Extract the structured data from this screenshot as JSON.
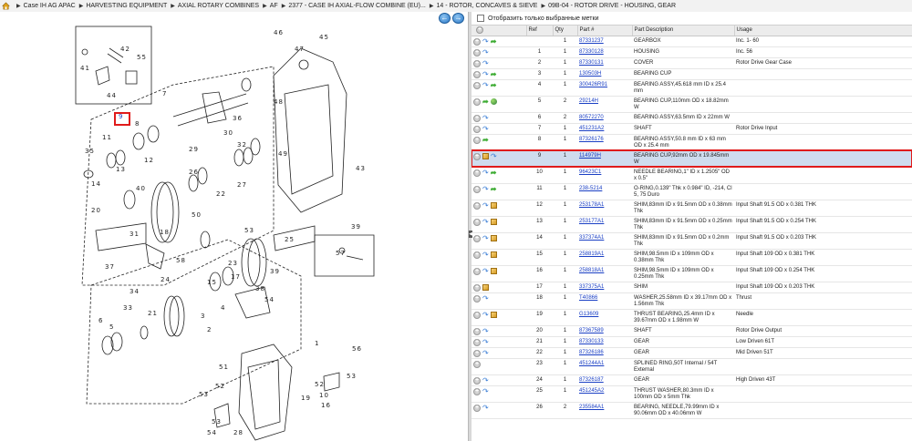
{
  "breadcrumb": [
    "Case IH AG APAC",
    "HARVESTING EQUIPMENT",
    "AXIAL ROTARY COMBINES",
    "AF",
    "2377 - CASE IH AXIAL-FLOW COMBINE (EU)...",
    "14 - ROTOR, CONCAVES & SIEVE",
    "09B-04 - ROTOR DRIVE - HOUSING, GEAR"
  ],
  "filter": {
    "label": "Отобразить только выбранные метки"
  },
  "nav": {
    "prev_icon": "left-arrow-icon",
    "next_icon": "right-arrow-icon"
  },
  "diagram": {
    "highlighted_callout": "9",
    "callouts": [
      "1",
      "2",
      "3",
      "4",
      "5",
      "6",
      "7",
      "8",
      "9",
      "10",
      "11",
      "12",
      "13",
      "14",
      "15",
      "16",
      "17",
      "18",
      "19",
      "20",
      "21",
      "22",
      "23",
      "24",
      "25",
      "26",
      "27",
      "28",
      "29",
      "30",
      "31",
      "32",
      "33",
      "34",
      "35",
      "36",
      "37",
      "38",
      "39",
      "40",
      "41",
      "42",
      "43",
      "44",
      "45",
      "46",
      "47",
      "48",
      "49",
      "50",
      "51",
      "52",
      "53",
      "54",
      "55",
      "56",
      "57",
      "58"
    ]
  },
  "table": {
    "headers": [
      "",
      "Ref",
      "Qty",
      "Part #",
      "Part Description",
      "Usage"
    ],
    "rows": [
      {
        "icons": [
          "plus",
          "blue",
          "green"
        ],
        "ref": "",
        "qty": "1",
        "part": "87331237",
        "desc": "GEARBOX",
        "usage": "Inc. 1- 60"
      },
      {
        "icons": [
          "plus",
          "blue"
        ],
        "ref": "1",
        "qty": "1",
        "part": "87330128",
        "desc": "HOUSING",
        "usage": "Inc. 56"
      },
      {
        "icons": [
          "plus",
          "blue"
        ],
        "ref": "2",
        "qty": "1",
        "part": "87330131",
        "desc": "COVER",
        "usage": "Rotor Drive Gear Case"
      },
      {
        "icons": [
          "plus",
          "blue",
          "green"
        ],
        "ref": "3",
        "qty": "1",
        "part": "130503H",
        "desc": "BEARING CUP",
        "usage": ""
      },
      {
        "icons": [
          "plus",
          "blue",
          "green"
        ],
        "ref": "4",
        "qty": "1",
        "part": "300426R91",
        "desc": "BEARING ASSY,45.618 mm ID x 25.4 mm",
        "usage": ""
      },
      {
        "icons": [
          "plus",
          "green",
          "globe"
        ],
        "ref": "5",
        "qty": "2",
        "part": "29214H",
        "desc": "BEARING CUP,110mm OD x 18.82mm W",
        "usage": ""
      },
      {
        "icons": [
          "plus",
          "blue"
        ],
        "ref": "6",
        "qty": "2",
        "part": "80572270",
        "desc": "BEARING ASSY,63.5mm ID x 22mm W",
        "usage": ""
      },
      {
        "icons": [
          "plus",
          "blue"
        ],
        "ref": "7",
        "qty": "1",
        "part": "451231A2",
        "desc": "SHAFT",
        "usage": "Rotor Drive Input"
      },
      {
        "icons": [
          "plus",
          "green"
        ],
        "ref": "8",
        "qty": "1",
        "part": "87326176",
        "desc": "BEARING ASSY,50.8 mm ID x 63 mm OD x 25.4 mm",
        "usage": ""
      },
      {
        "icons": [
          "plus",
          "box",
          "blue"
        ],
        "ref": "9",
        "qty": "1",
        "part": "114979H",
        "desc": "BEARING CUP,92mm OD x 19.845mm W",
        "usage": "",
        "highlight": true
      },
      {
        "icons": [
          "plus",
          "blue",
          "green"
        ],
        "ref": "10",
        "qty": "1",
        "part": "96423C1",
        "desc": "NEEDLE BEARING,1\" ID x 1.2505\" OD x 0.5\"",
        "usage": ""
      },
      {
        "icons": [
          "plus",
          "blue",
          "green"
        ],
        "ref": "11",
        "qty": "1",
        "part": "238-5214",
        "desc": "O-RING,0.139\" Thk x 0.984\" ID, -214, Cl 5, 75 Duro",
        "usage": ""
      },
      {
        "icons": [
          "plus",
          "blue",
          "box"
        ],
        "ref": "12",
        "qty": "1",
        "part": "253178A1",
        "desc": "SHIM,83mm ID x 91.5mm OD x 0.38mm Thk",
        "usage": "Input Shaft 91.5 OD x 0.381 THK"
      },
      {
        "icons": [
          "plus",
          "blue",
          "box"
        ],
        "ref": "13",
        "qty": "1",
        "part": "253177A1",
        "desc": "SHIM,83mm ID x 91.5mm OD x 0.25mm Thk",
        "usage": "Input Shaft 91.5 OD x 0.254 THK"
      },
      {
        "icons": [
          "plus",
          "blue",
          "box"
        ],
        "ref": "14",
        "qty": "1",
        "part": "337374A1",
        "desc": "SHIM,83mm ID x 91.5mm OD x 0.2mm Thk",
        "usage": "Input Shaft 91.5 OD x 0.203 THK"
      },
      {
        "icons": [
          "plus",
          "blue",
          "box"
        ],
        "ref": "15",
        "qty": "1",
        "part": "258819A1",
        "desc": "SHIM,98.5mm ID x 109mm OD x 0.38mm Thk",
        "usage": "Input Shaft 109 OD x 0.381 THK"
      },
      {
        "icons": [
          "plus",
          "blue",
          "box"
        ],
        "ref": "16",
        "qty": "1",
        "part": "258818A1",
        "desc": "SHIM,98.5mm ID x 109mm OD x 0.25mm Thk",
        "usage": "Input Shaft 109 OD x 0.254 THK"
      },
      {
        "icons": [
          "plus",
          "box"
        ],
        "ref": "17",
        "qty": "1",
        "part": "337375A1",
        "desc": "SHIM",
        "usage": "Input Shaft 109 OD x 0.203 THK"
      },
      {
        "icons": [
          "plus",
          "blue"
        ],
        "ref": "18",
        "qty": "1",
        "part": "T40866",
        "desc": "WASHER,25.58mm ID x 39.17mm OD x 1.56mm Thk",
        "usage": "Thrust"
      },
      {
        "icons": [
          "plus",
          "blue",
          "box"
        ],
        "ref": "19",
        "qty": "1",
        "part": "G13609",
        "desc": "THRUST BEARING,25.4mm ID x 39.67mm OD x 1.98mm W",
        "usage": "Needle"
      },
      {
        "icons": [
          "plus",
          "blue"
        ],
        "ref": "20",
        "qty": "1",
        "part": "87367589",
        "desc": "SHAFT",
        "usage": "Rotor Drive Output"
      },
      {
        "icons": [
          "plus",
          "blue"
        ],
        "ref": "21",
        "qty": "1",
        "part": "87330133",
        "desc": "GEAR",
        "usage": "Low Driven 61T"
      },
      {
        "icons": [
          "plus",
          "blue"
        ],
        "ref": "22",
        "qty": "1",
        "part": "87326186",
        "desc": "GEAR",
        "usage": "Mid Driven 51T"
      },
      {
        "icons": [
          "plus"
        ],
        "ref": "23",
        "qty": "1",
        "part": "451244A1",
        "desc": "SPLINED RING,50T Internal / 54T External",
        "usage": ""
      },
      {
        "icons": [
          "plus",
          "blue"
        ],
        "ref": "24",
        "qty": "1",
        "part": "87326187",
        "desc": "GEAR",
        "usage": "High Driven 43T"
      },
      {
        "icons": [
          "plus",
          "blue"
        ],
        "ref": "25",
        "qty": "1",
        "part": "451245A2",
        "desc": "THRUST WASHER,80.3mm ID x 100mm OD x 5mm Thk",
        "usage": ""
      },
      {
        "icons": [
          "plus",
          "blue"
        ],
        "ref": "26",
        "qty": "2",
        "part": "235584A1",
        "desc": "BEARING, NEEDLE,79.99mm ID x 90.06mm OD x 40.06mm W",
        "usage": ""
      }
    ]
  }
}
